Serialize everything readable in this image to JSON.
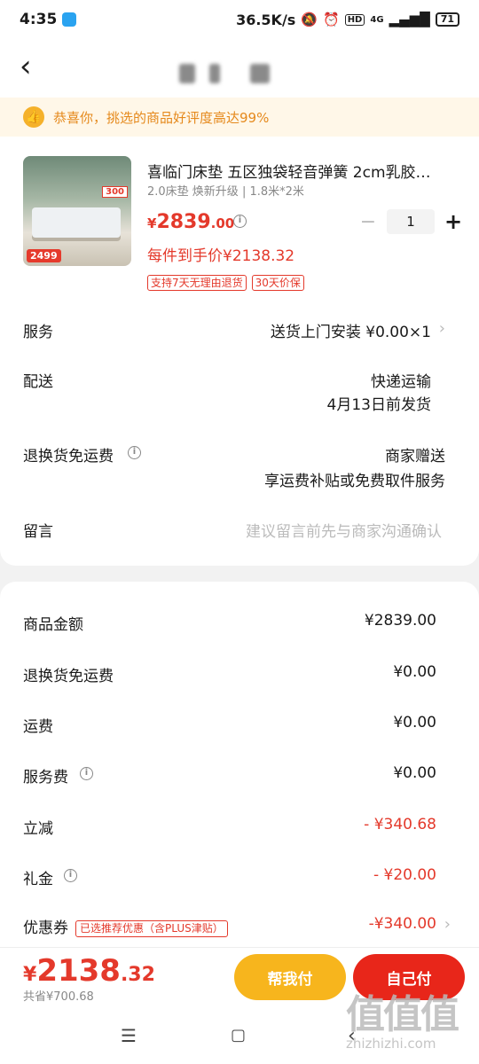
{
  "status_bar": {
    "time": "4:35",
    "net_speed": "36.5K/s",
    "network": "4G",
    "battery": "71"
  },
  "banner": {
    "text": "恭喜你，挑选的商品好评度高达99%"
  },
  "product": {
    "title": "喜临门床垫 五区独袋轻音弹簧 2cm乳胶…",
    "spec": "2.0床垫 焕新升级 | 1.8米*2米",
    "price_symbol": "¥",
    "price_int": "2839",
    "price_dec": ".00",
    "net_price": "每件到手价¥2138.32",
    "quantity": "1",
    "badges": [
      "支持7天无理由退货",
      "30天价保"
    ],
    "image_price_tag": "2499",
    "image_tag": "300"
  },
  "order_info": {
    "service": {
      "label": "服务",
      "value": "送货上门安装  ¥0.00×1"
    },
    "delivery": {
      "label": "配送",
      "line1": "快递运输",
      "line2": "4月13日前发货"
    },
    "return": {
      "label": "退换货免运费",
      "line1": "商家赠送",
      "line2": "享运费补贴或免费取件服务"
    },
    "message": {
      "label": "留言",
      "placeholder": "建议留言前先与商家沟通确认"
    }
  },
  "summary": {
    "goods_amount": {
      "label": "商品金额",
      "value": "¥2839.00"
    },
    "return_fee": {
      "label": "退换货免运费",
      "value": "¥0.00"
    },
    "shipping": {
      "label": "运费",
      "value": "¥0.00"
    },
    "service_fee": {
      "label": "服务费",
      "value": "¥0.00"
    },
    "instant_discount": {
      "label": "立减",
      "value": "- ¥340.68"
    },
    "gift_money": {
      "label": "礼金",
      "value": "- ¥20.00"
    },
    "coupon": {
      "label": "优惠券",
      "tag": "已选推荐优惠（含PLUS津贴）",
      "value": "-¥340.00"
    }
  },
  "bottom": {
    "total_symbol": "¥",
    "total_int": "2138",
    "total_dec": ".32",
    "saved": "共省¥700.68",
    "help_pay": "帮我付",
    "self_pay": "自己付"
  },
  "watermark": {
    "big": "值值值",
    "small": "zhizhizhi.com"
  },
  "colors": {
    "accent_red": "#e4392b",
    "accent_yellow": "#f7b51d",
    "banner_bg": "#fff7e8"
  }
}
